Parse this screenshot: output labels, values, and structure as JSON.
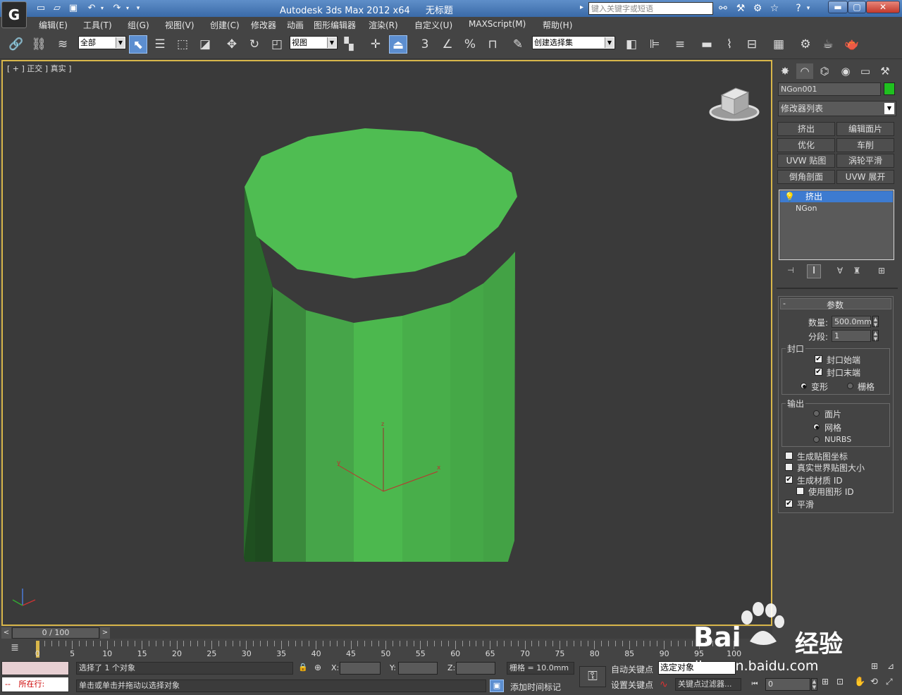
{
  "window": {
    "title": "Autodesk 3ds Max  2012 x64",
    "doc_title": "无标题",
    "search_placeholder": "键入关键字或短语",
    "logo_glyph": "G"
  },
  "menu": [
    "编辑(E)",
    "工具(T)",
    "组(G)",
    "视图(V)",
    "创建(C)",
    "修改器",
    "动画",
    "图形编辑器",
    "渲染(R)",
    "自定义(U)",
    "MAXScript(M)",
    "帮助(H)"
  ],
  "toolbar": {
    "filter": "全部",
    "ref_coord": "视图",
    "named_selection": "创建选择集",
    "snap_label": "3",
    "percent_label": "%"
  },
  "viewport": {
    "label": "[ + ] 正交 ] 真实 ]",
    "object_color": "#4cb84e",
    "axis_x": "x",
    "axis_y": "y",
    "axis_z": "z"
  },
  "command_panel": {
    "object_name": "NGon001",
    "object_color": "#1fc01f",
    "modifier_list": "修改器列表",
    "modifier_buttons": [
      "挤出",
      "编辑面片",
      "优化",
      "车削",
      "UVW 贴图",
      "涡轮平滑",
      "倒角剖面",
      "UVW 展开"
    ],
    "stack": [
      "挤出",
      "NGon"
    ],
    "rollout_title": "参数",
    "rollout_toggle": "-",
    "amount_label": "数量:",
    "amount_value": "500.0mm",
    "segments_label": "分段:",
    "segments_value": "1",
    "capping_title": "封口",
    "cap_start": "封口始端",
    "cap_end": "封口末端",
    "morph": "变形",
    "grid": "栅格",
    "output_title": "输出",
    "out_patch": "面片",
    "out_mesh": "网格",
    "out_nurbs": "NURBS",
    "gen_map_coords": "生成贴图坐标",
    "real_world": "真实世界贴图大小",
    "gen_mat_id": "生成材质 ID",
    "use_shape_id": "使用图形 ID",
    "smooth": "平滑",
    "checks": {
      "cap_start": true,
      "cap_end": true,
      "gen_map_coords": false,
      "real_world": false,
      "gen_mat_id": true,
      "use_shape_id": false,
      "smooth": true
    }
  },
  "timeline": {
    "frame_display": "0 / 100",
    "ticks": [
      "0",
      "5",
      "10",
      "15",
      "20",
      "25",
      "30",
      "35",
      "40",
      "45",
      "50",
      "55",
      "60",
      "65",
      "70",
      "75",
      "80",
      "85",
      "90",
      "95",
      "100"
    ]
  },
  "status": {
    "selection": "选择了 1 个对象",
    "prompt": "单击或单击并拖动以选择对象",
    "mode": "所在行:",
    "x_label": "X:",
    "y_label": "Y:",
    "z_label": "Z:",
    "grid": "栅格 = 10.0mm",
    "add_time_tag": "添加时间标记",
    "auto_key": "自动关键点",
    "set_key": "设置关键点",
    "selected_obj": "选定对象",
    "key_filters": "关键点过滤器...",
    "frame_value": "0"
  },
  "watermark": {
    "brand": "Bai",
    "brand2": "经验",
    "url": "jingyan.baidu.com"
  }
}
